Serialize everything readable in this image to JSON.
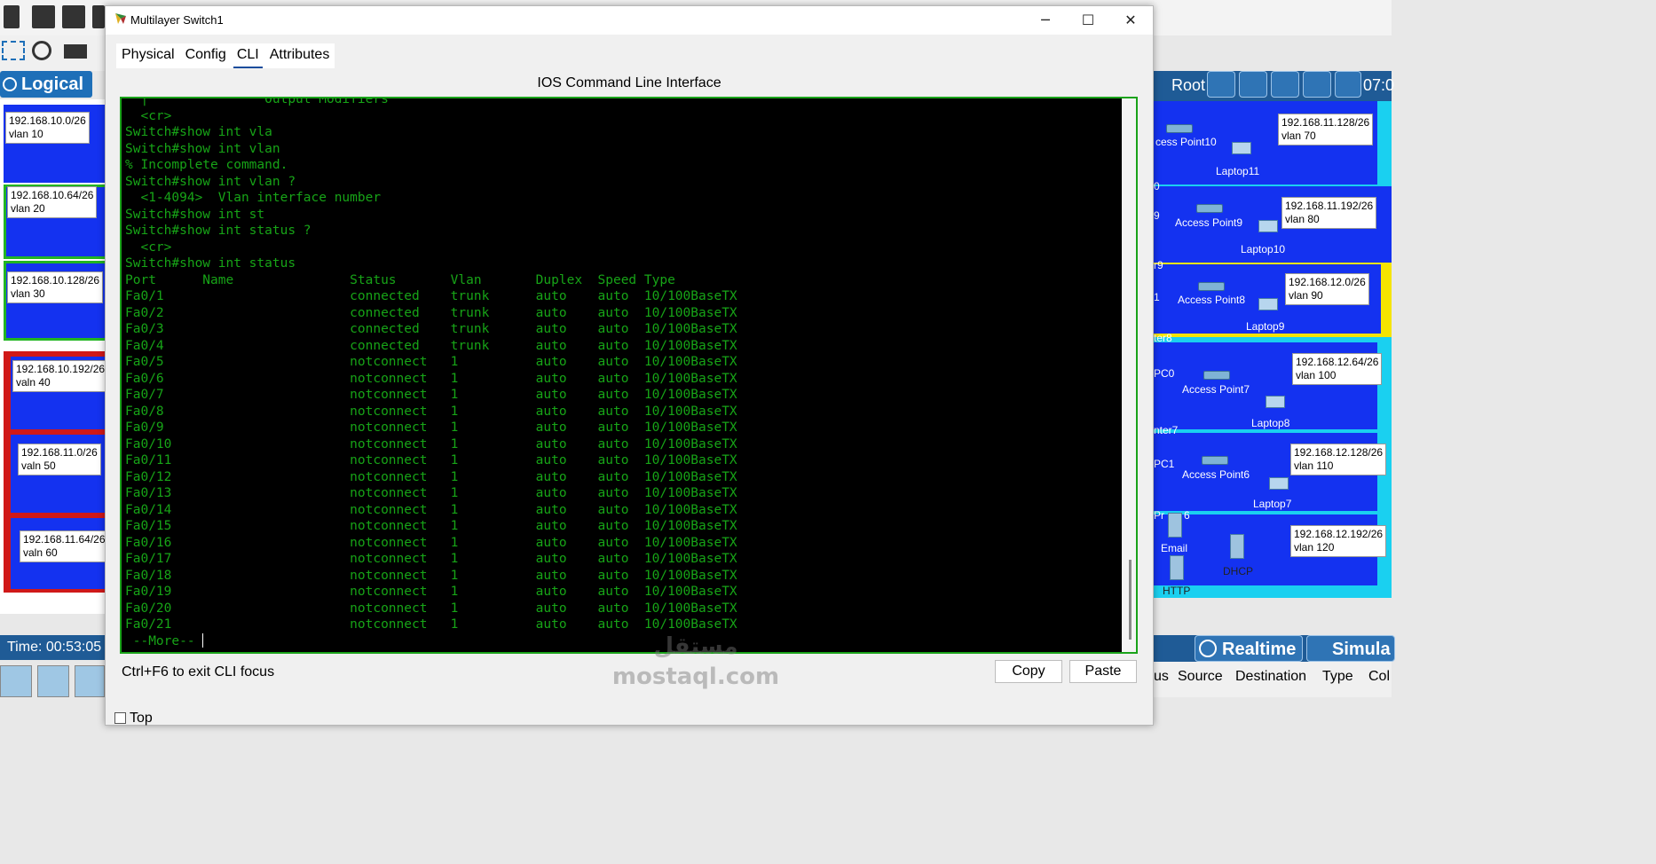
{
  "window": {
    "title": "Multilayer Switch1",
    "minimize_glyph": "─",
    "maximize_glyph": "☐",
    "close_glyph": "✕"
  },
  "tabs": [
    {
      "label": "Physical",
      "active": false
    },
    {
      "label": "Config",
      "active": false
    },
    {
      "label": "CLI",
      "active": true
    },
    {
      "label": "Attributes",
      "active": false
    }
  ],
  "cli": {
    "heading": "IOS Command Line Interface",
    "lines": [
      "  |               Output Modifiers",
      "  <cr>",
      "Switch#show int vla",
      "Switch#show int vlan",
      "% Incomplete command.",
      "Switch#show int vlan ?",
      "  <1-4094>  Vlan interface number",
      "Switch#show int st",
      "Switch#show int status ?",
      "  <cr>",
      "Switch#show int status",
      "Port      Name               Status       Vlan       Duplex  Speed Type",
      "Fa0/1                        connected    trunk      auto    auto  10/100BaseTX",
      "Fa0/2                        connected    trunk      auto    auto  10/100BaseTX",
      "Fa0/3                        connected    trunk      auto    auto  10/100BaseTX",
      "Fa0/4                        connected    trunk      auto    auto  10/100BaseTX",
      "Fa0/5                        notconnect   1          auto    auto  10/100BaseTX",
      "Fa0/6                        notconnect   1          auto    auto  10/100BaseTX",
      "Fa0/7                        notconnect   1          auto    auto  10/100BaseTX",
      "Fa0/8                        notconnect   1          auto    auto  10/100BaseTX",
      "Fa0/9                        notconnect   1          auto    auto  10/100BaseTX",
      "Fa0/10                       notconnect   1          auto    auto  10/100BaseTX",
      "Fa0/11                       notconnect   1          auto    auto  10/100BaseTX",
      "Fa0/12                       notconnect   1          auto    auto  10/100BaseTX",
      "Fa0/13                       notconnect   1          auto    auto  10/100BaseTX",
      "Fa0/14                       notconnect   1          auto    auto  10/100BaseTX",
      "Fa0/15                       notconnect   1          auto    auto  10/100BaseTX",
      "Fa0/16                       notconnect   1          auto    auto  10/100BaseTX",
      "Fa0/17                       notconnect   1          auto    auto  10/100BaseTX",
      "Fa0/18                       notconnect   1          auto    auto  10/100BaseTX",
      "Fa0/19                       notconnect   1          auto    auto  10/100BaseTX",
      "Fa0/20                       notconnect   1          auto    auto  10/100BaseTX",
      "Fa0/21                       notconnect   1          auto    auto  10/100BaseTX"
    ],
    "more_prompt": " --More-- ",
    "text_color": "#17a417",
    "border_color": "#1aa31a"
  },
  "footer": {
    "exit_hint": "Ctrl+F6 to exit CLI focus",
    "copy_label": "Copy",
    "paste_label": "Paste",
    "top_label": "Top"
  },
  "background": {
    "logical_label": "Logical",
    "root_label": "Root",
    "clock_partial": "07:0",
    "time_label": "Time: 00:53:05",
    "realtime_label": "Realtime",
    "simulation_partial": "Simula",
    "pdu_columns": [
      "us",
      "Source",
      "Destination",
      "Type",
      "Col"
    ],
    "left_labels": [
      "192.168.10.0/26\nvlan 10",
      "192.168.10.64/26\nvlan 20",
      "192.168.10.128/26\nvlan 30",
      "192.168.10.192/26\nvaln 40",
      "192.168.11.0/26\nvaln 50",
      "192.168.11.64/26\nvaln 60"
    ],
    "right_labels": [
      "192.168.11.128/26\nvlan 70",
      "192.168.11.192/26\nvlan 80",
      "192.168.12.0/26\nvlan 90",
      "192.168.12.64/26\nvlan 100",
      "192.168.12.128/26\nvlan 110",
      "192.168.12.192/26\nvlan 120"
    ],
    "device_labels": [
      "cess Point10",
      "Laptop11",
      "Access Point9",
      "Laptop10",
      "Access Point8",
      "Laptop9",
      "Access Point7",
      "Laptop8",
      "Access Point6",
      "Laptop7",
      "Email",
      "DHCP",
      "HTTP",
      "0",
      "9",
      "r9",
      "1",
      "ter8",
      "PC0",
      "nter7",
      "PC1",
      "Pr",
      "6"
    ],
    "zone_blue": "#1432f0",
    "zone_green": "#22b522",
    "zone_red": "#d01818",
    "zone_yellow": "#f5e400",
    "zone_cyan": "#1ad0f0"
  },
  "watermark": {
    "line1": "مستقل",
    "line2": "mostaql.com"
  }
}
